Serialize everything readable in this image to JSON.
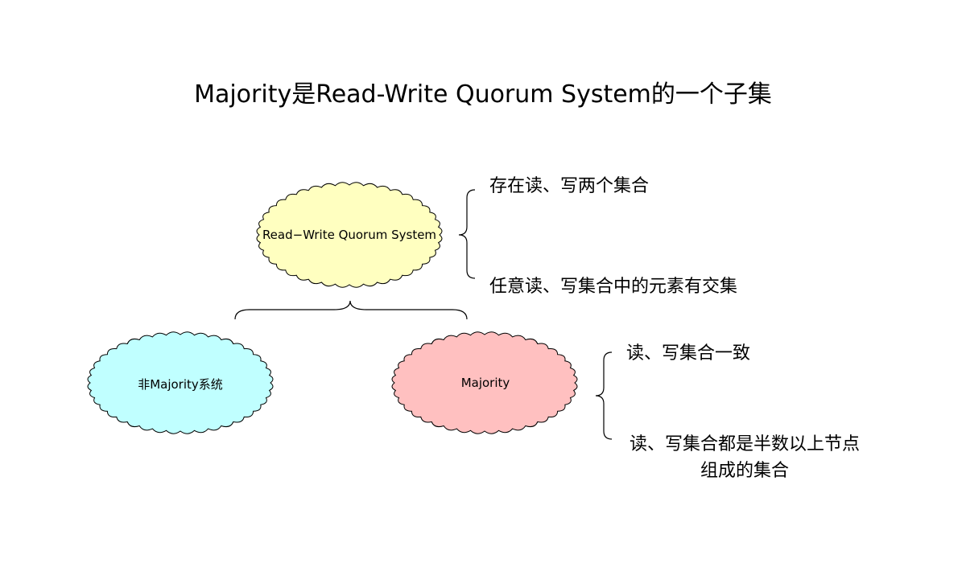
{
  "title": "Majority是Read-Write Quorum System的一个子集",
  "nodes": {
    "rw_system": {
      "label": "Read−Write Quorum System",
      "fill": "#ffffc0"
    },
    "non_majority": {
      "label": "非Majority系统",
      "fill": "#c0ffff"
    },
    "majority": {
      "label": "Majority",
      "fill": "#ffc0c0"
    }
  },
  "rw_properties": [
    "存在读、写两个集合",
    "任意读、写集合中的元素有交集"
  ],
  "majority_properties": [
    "读、写集合一致",
    "读、写集合都是半数以上节点",
    "组成的集合"
  ],
  "colors": {
    "stroke": "#000000"
  }
}
